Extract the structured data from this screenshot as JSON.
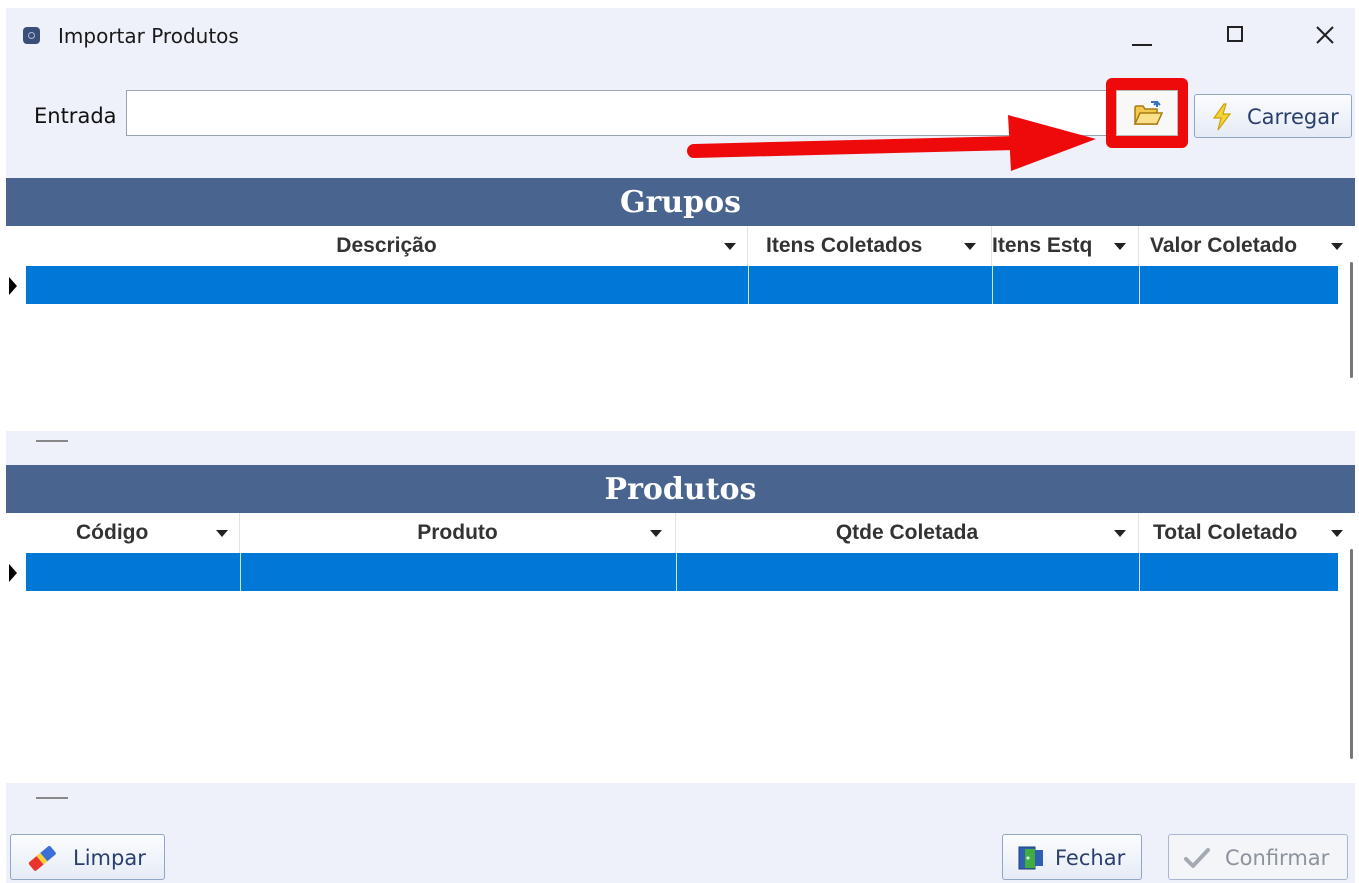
{
  "window": {
    "title": "Importar Produtos"
  },
  "entrada": {
    "label": "Entrada",
    "value": "",
    "carregar_label": "Carregar"
  },
  "grupos": {
    "title": "Grupos",
    "columns": [
      "Descrição",
      "Itens Coletados",
      "Itens Estq",
      "Valor Coletado"
    ]
  },
  "produtos": {
    "title": "Produtos",
    "columns": [
      "Código",
      "Produto",
      "Qtde Coletada",
      "Total Coletado"
    ]
  },
  "footer": {
    "limpar_label": "Limpar",
    "fechar_label": "Fechar",
    "confirmar_label": "Confirmar"
  },
  "colors": {
    "header_bg": "#4a6490",
    "selected_row": "#0078d7",
    "annotation_red": "#ee0a0a"
  }
}
